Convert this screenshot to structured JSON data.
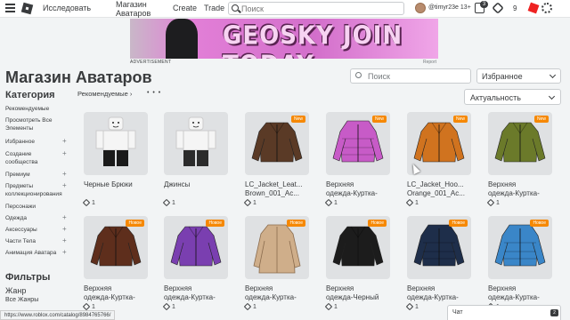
{
  "topnav": {
    "links": [
      "Исследовать",
      "Магазин",
      "Аватаров",
      "Create",
      "Trade"
    ],
    "search_placeholder": "Поиск",
    "username": "@timyr23e",
    "username_suffix": "13+",
    "messages_badge": "3",
    "robux": "9"
  },
  "banner": {
    "text": "GEOSKY JOIN TODAY",
    "ad_label": "ADVERTISEMENT",
    "report_label": "Report"
  },
  "header": {
    "title": "Магазин Аватаров",
    "search_placeholder": "Поиск",
    "favorites_select": "Избранное"
  },
  "sidebar": {
    "category_title": "Категория",
    "items": [
      {
        "label": "Рекомендуемые",
        "expandable": false
      },
      {
        "label": "Просмотреть Все Элементы",
        "expandable": false
      },
      {
        "label": "Избранное",
        "expandable": true
      },
      {
        "label": "Создание сообщества",
        "expandable": true
      },
      {
        "label": "Премиум",
        "expandable": true
      },
      {
        "label": "Предметы коллекционирования",
        "expandable": true
      },
      {
        "label": "Персонажи",
        "expandable": false
      },
      {
        "label": "Одежда",
        "expandable": true
      },
      {
        "label": "Аксессуары",
        "expandable": true
      },
      {
        "label": "Части Тела",
        "expandable": true
      },
      {
        "label": "Анимация Аватара",
        "expandable": true
      }
    ],
    "filters_title": "Фильтры",
    "genre_title": "Жанр",
    "genre_value": "Все Жанры"
  },
  "main": {
    "recommended_label": "Рекомендуемые",
    "sort_select": "Актуальность",
    "new_badge": "New",
    "items": [
      {
        "name1": "Черные Брюки",
        "name2": "",
        "price": "1",
        "badge": "",
        "color": "#f5f5f5",
        "kind": "pants"
      },
      {
        "name1": "Джинсы",
        "name2": "",
        "price": "1",
        "badge": "",
        "color": "#f5f5f5",
        "kind": "pants"
      },
      {
        "name1": "LC_Jacket_Leat...",
        "name2": "Brown_001_Ac...",
        "price": "1",
        "badge": "New",
        "color": "#5a3a26",
        "kind": "jacket"
      },
      {
        "name1": "Верхняя",
        "name2": "одежда-Куртка-",
        "price": "1",
        "badge": "New",
        "color": "#c75bc7",
        "kind": "puffer"
      },
      {
        "name1": "LC_Jacket_Hoo...",
        "name2": "Orange_001_Ac...",
        "price": "1",
        "badge": "New",
        "color": "#d0731f",
        "kind": "jacket"
      },
      {
        "name1": "Верхняя",
        "name2": "одежда-Куртка-",
        "price": "1",
        "badge": "New",
        "color": "#6b7a2a",
        "kind": "jacket"
      },
      {
        "name1": "Верхняя",
        "name2": "одежда-Куртка-",
        "price": "1",
        "badge": "Новое",
        "color": "#5e2e1c",
        "kind": "jacket"
      },
      {
        "name1": "Верхняя",
        "name2": "одежда-Куртка-",
        "price": "1",
        "badge": "Новое",
        "color": "#7a3fb0",
        "kind": "jacket"
      },
      {
        "name1": "Верхняя",
        "name2": "одежда-Куртка-",
        "price": "1",
        "badge": "Новое",
        "color": "#cfae8a",
        "kind": "coat"
      },
      {
        "name1": "Верхняя",
        "name2": "одежда-Черный",
        "price": "1",
        "badge": "Новое",
        "color": "#1c1c1c",
        "kind": "jacket"
      },
      {
        "name1": "Верхняя",
        "name2": "одежда-Куртка-",
        "price": "1",
        "badge": "Новое",
        "color": "#1e2e4a",
        "kind": "puffer"
      },
      {
        "name1": "Верхняя",
        "name2": "одежда-Куртка-",
        "price": "1",
        "badge": "Новое",
        "color": "#3a86c8",
        "kind": "puffer"
      }
    ]
  },
  "statusbar": {
    "url": "https://www.roblox.com/catalog/8984765766/"
  },
  "chat": {
    "label": "Чат",
    "count": "2"
  }
}
